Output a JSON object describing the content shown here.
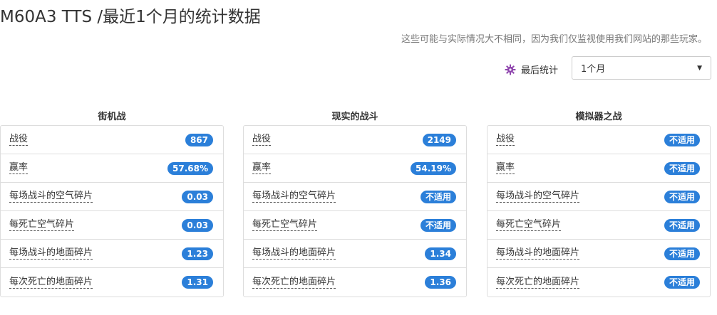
{
  "header": {
    "title": "M60A3 TTS /最近1个月的统计数据",
    "disclaimer": "这些可能与实际情况大不相同，因为我们仅监视使用我们网站的那些玩家。"
  },
  "filter": {
    "label": "最后统计",
    "selected": "1个月",
    "icon": "gear-icon",
    "icon_color": "#8e44ad"
  },
  "accent_color": "#2b7fd9",
  "columns": [
    {
      "title": "街机战",
      "rows": [
        {
          "label": "战役",
          "value": "867"
        },
        {
          "label": "赢率",
          "value": "57.68%"
        },
        {
          "label": "每场战斗的空气碎片",
          "value": "0.03"
        },
        {
          "label": "每死亡空气碎片",
          "value": "0.03"
        },
        {
          "label": "每场战斗的地面碎片",
          "value": "1.23"
        },
        {
          "label": "每次死亡的地面碎片",
          "value": "1.31"
        }
      ]
    },
    {
      "title": "现实的战斗",
      "rows": [
        {
          "label": "战役",
          "value": "2149"
        },
        {
          "label": "赢率",
          "value": "54.19%"
        },
        {
          "label": "每场战斗的空气碎片",
          "value": "不适用"
        },
        {
          "label": "每死亡空气碎片",
          "value": "不适用"
        },
        {
          "label": "每场战斗的地面碎片",
          "value": "1.34"
        },
        {
          "label": "每次死亡的地面碎片",
          "value": "1.36"
        }
      ]
    },
    {
      "title": "模拟器之战",
      "rows": [
        {
          "label": "战役",
          "value": "不适用"
        },
        {
          "label": "赢率",
          "value": "不适用"
        },
        {
          "label": "每场战斗的空气碎片",
          "value": "不适用"
        },
        {
          "label": "每死亡空气碎片",
          "value": "不适用"
        },
        {
          "label": "每场战斗的地面碎片",
          "value": "不适用"
        },
        {
          "label": "每次死亡的地面碎片",
          "value": "不适用"
        }
      ]
    }
  ]
}
